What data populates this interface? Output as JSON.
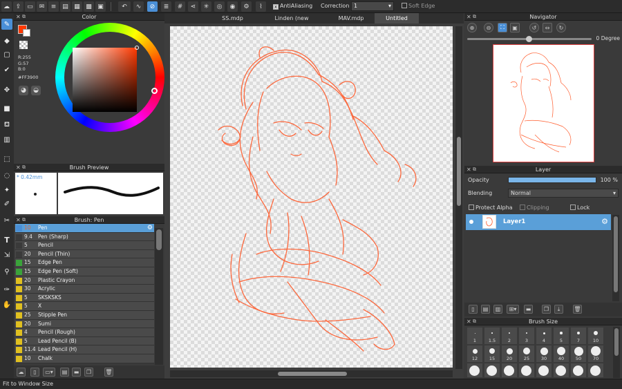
{
  "toolbar": {
    "antialias_label": "AntiAliasing",
    "correction_label": "Correction",
    "correction_value": "1",
    "soft_edge_label": "Soft Edge"
  },
  "tabs": [
    {
      "label": "SS.mdp"
    },
    {
      "label": "Linden (new version).mdp"
    },
    {
      "label": "MAV.mdp"
    },
    {
      "label": "Untitled"
    }
  ],
  "color_panel": {
    "title": "Color",
    "r": "R:255",
    "g": "G:57",
    "b": "B:0",
    "hex": "#FF3900",
    "accent": "#ff3900"
  },
  "brush_preview": {
    "title": "Brush Preview",
    "size": "* 0.42mm"
  },
  "brush_list": {
    "title": "Brush: Pen",
    "items": [
      {
        "size": "10",
        "name": "Pen",
        "color": "#4a8fd6"
      },
      {
        "size": "9.4",
        "name": "Pen (Sharp)",
        "color": "#3a3a3a"
      },
      {
        "size": "5",
        "name": "Pencil",
        "color": "#3a3a3a"
      },
      {
        "size": "20",
        "name": "Pencil (Thin)",
        "color": "#3a3a3a"
      },
      {
        "size": "15",
        "name": "Edge Pen",
        "color": "#3aa33a"
      },
      {
        "size": "15",
        "name": "Edge Pen (Soft)",
        "color": "#3aa33a"
      },
      {
        "size": "20",
        "name": "Plastic Crayon",
        "color": "#e0c020"
      },
      {
        "size": "30",
        "name": "Acrylic",
        "color": "#e0c020"
      },
      {
        "size": "5",
        "name": "SKSKSKS",
        "color": "#e0c020"
      },
      {
        "size": "5",
        "name": "X",
        "color": "#e0c020"
      },
      {
        "size": "25",
        "name": "Stipple Pen",
        "color": "#e0c020"
      },
      {
        "size": "20",
        "name": "Sumi",
        "color": "#e0c020"
      },
      {
        "size": "4",
        "name": "Pencil (Rough)",
        "color": "#e0c020"
      },
      {
        "size": "5",
        "name": "Lead Pencil (B)",
        "color": "#e0c020"
      },
      {
        "size": "11.4",
        "name": "Lead Pencil (H)",
        "color": "#e0c020"
      },
      {
        "size": "10",
        "name": "Chalk",
        "color": "#e0c020"
      }
    ]
  },
  "navigator": {
    "title": "Navigator",
    "angle": "0 Degree"
  },
  "layer_panel": {
    "title": "Layer",
    "opacity_label": "Opacity",
    "opacity_value": "100 %",
    "opacity_fraction": 1.0,
    "blending_label": "Blending",
    "blending_value": "Normal",
    "protect_alpha": "Protect Alpha",
    "clipping": "Clipping",
    "lock": "Lock",
    "layer_name": "Layer1"
  },
  "brush_size": {
    "title": "Brush Size",
    "row1": [
      "1",
      "1.5",
      "2",
      "3",
      "4",
      "5",
      "7",
      "10"
    ],
    "row2": [
      "12",
      "15",
      "20",
      "25",
      "30",
      "40",
      "50",
      "70"
    ]
  },
  "status": {
    "text": "Fit to Window Size"
  }
}
